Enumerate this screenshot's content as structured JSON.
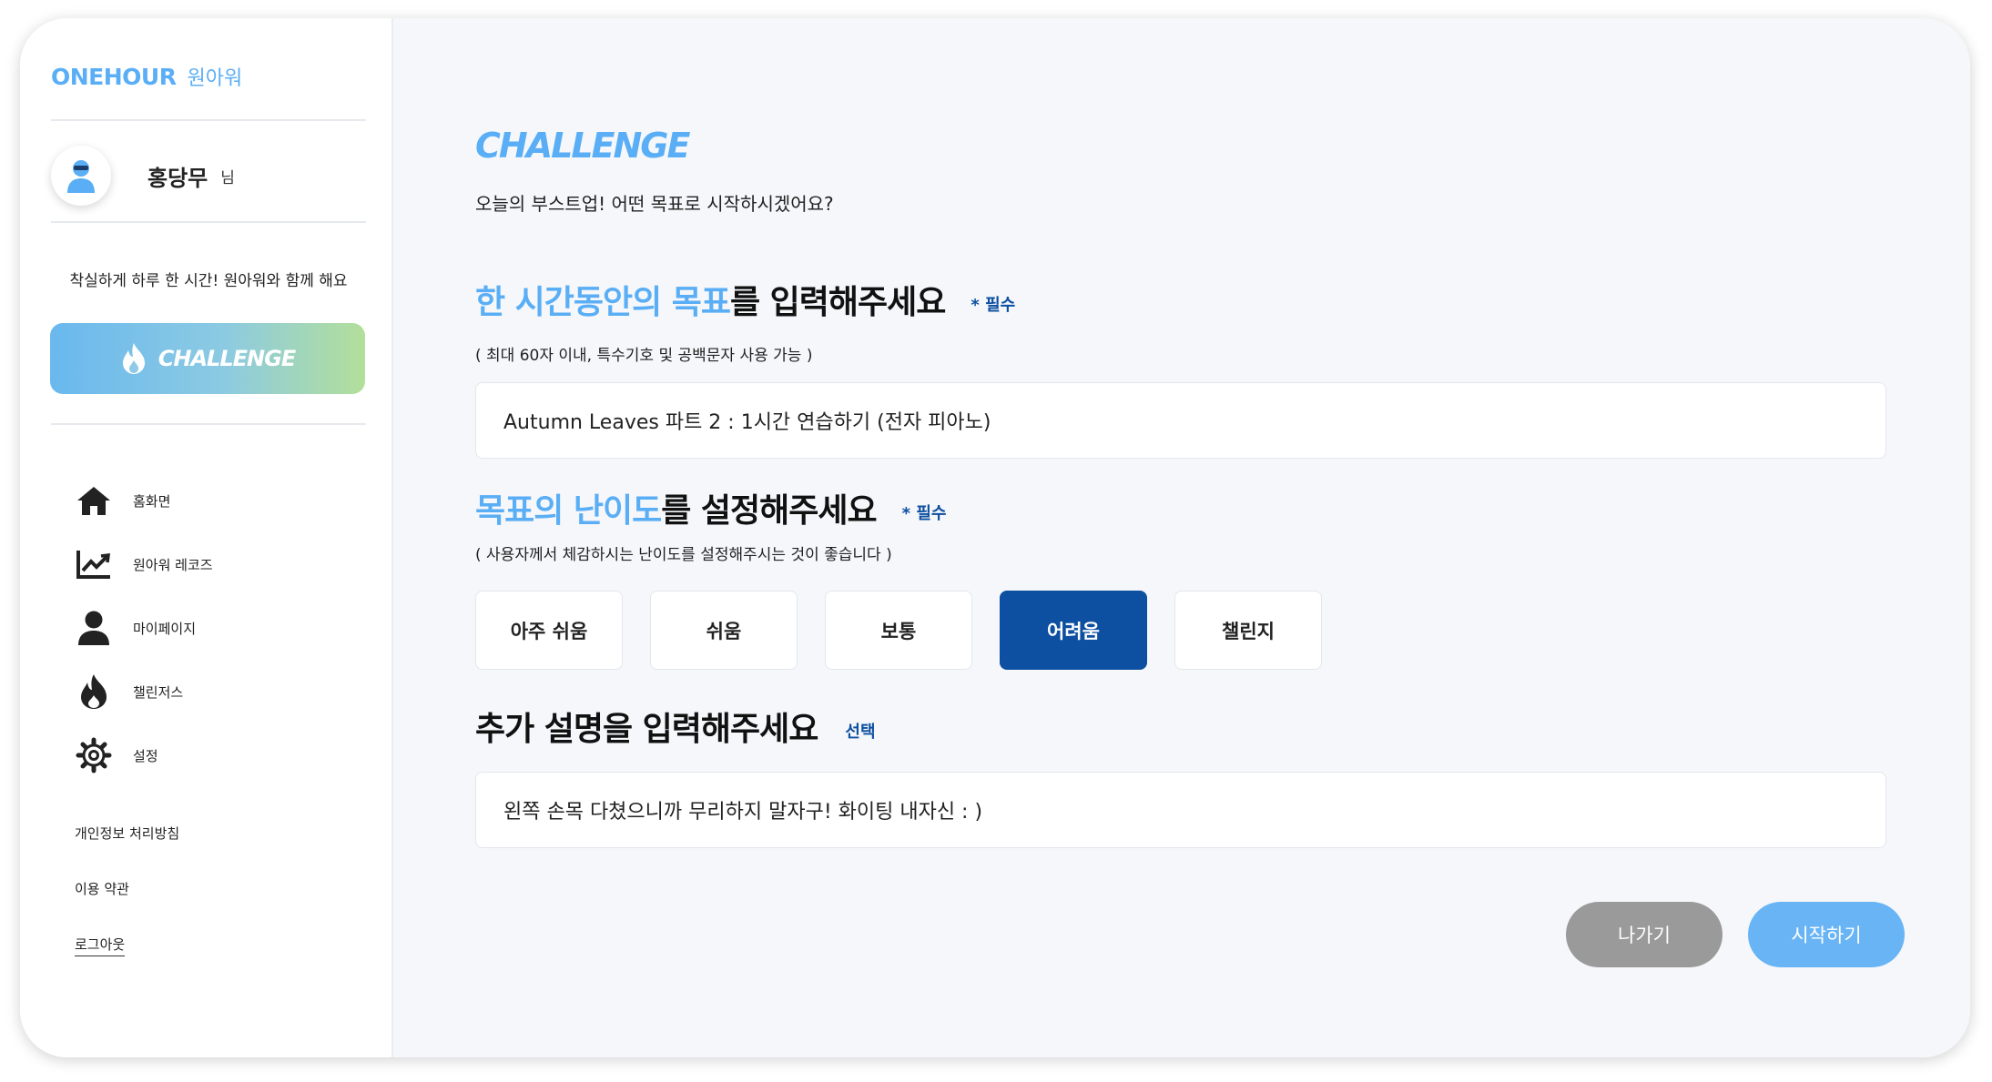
{
  "brand": {
    "name_en": "ONEHOUR",
    "name_ko": "원아워",
    "accent": "#5aaef5",
    "primary": "#0d4fa0"
  },
  "user": {
    "name": "홍당무",
    "suffix": "님",
    "avatar_icon": "user-avatar-icon"
  },
  "sidebar": {
    "slogan": "착실하게 하루 한 시간! 원아워와 함께 해요",
    "challenge_button": "CHALLENGE",
    "nav": [
      {
        "label": "홈화면",
        "icon": "home-icon"
      },
      {
        "label": "원아워 레코즈",
        "icon": "chart-icon"
      },
      {
        "label": "마이페이지",
        "icon": "user-icon"
      },
      {
        "label": "챌린저스",
        "icon": "fire-icon"
      },
      {
        "label": "설정",
        "icon": "gear-icon"
      }
    ],
    "footer": {
      "privacy": "개인정보 처리방침",
      "terms": "이용 약관",
      "logout": "로그아웃"
    }
  },
  "main": {
    "header_logo": "CHALLENGE",
    "subtitle": "오늘의 부스트업! 어떤 목표로 시작하시겠어요?",
    "goal": {
      "title_highlight": "한 시간동안의 목표",
      "title_rest": "를 입력해주세요",
      "required": "* 필수",
      "hint": "( 최대 60자 이내, 특수기호 및 공백문자 사용 가능 )",
      "value": "Autumn Leaves 파트 2 : 1시간 연습하기 (전자 피아노)"
    },
    "difficulty": {
      "title_highlight": "목표의 난이도",
      "title_rest": "를 설정해주세요",
      "required": "* 필수",
      "hint": "( 사용자께서 체감하시는 난이도를 설정해주시는 것이 좋습니다 )",
      "levels": [
        "아주 쉬움",
        "쉬움",
        "보통",
        "어려움",
        "챌린지"
      ],
      "selected": "어려움"
    },
    "description": {
      "title": "추가 설명을 입력해주세요",
      "optional": "선택",
      "value": "왼쪽 손목 다쳤으니까 무리하지 말자구! 화이팅 내자신 : )"
    },
    "buttons": {
      "exit": "나가기",
      "start": "시작하기"
    }
  }
}
